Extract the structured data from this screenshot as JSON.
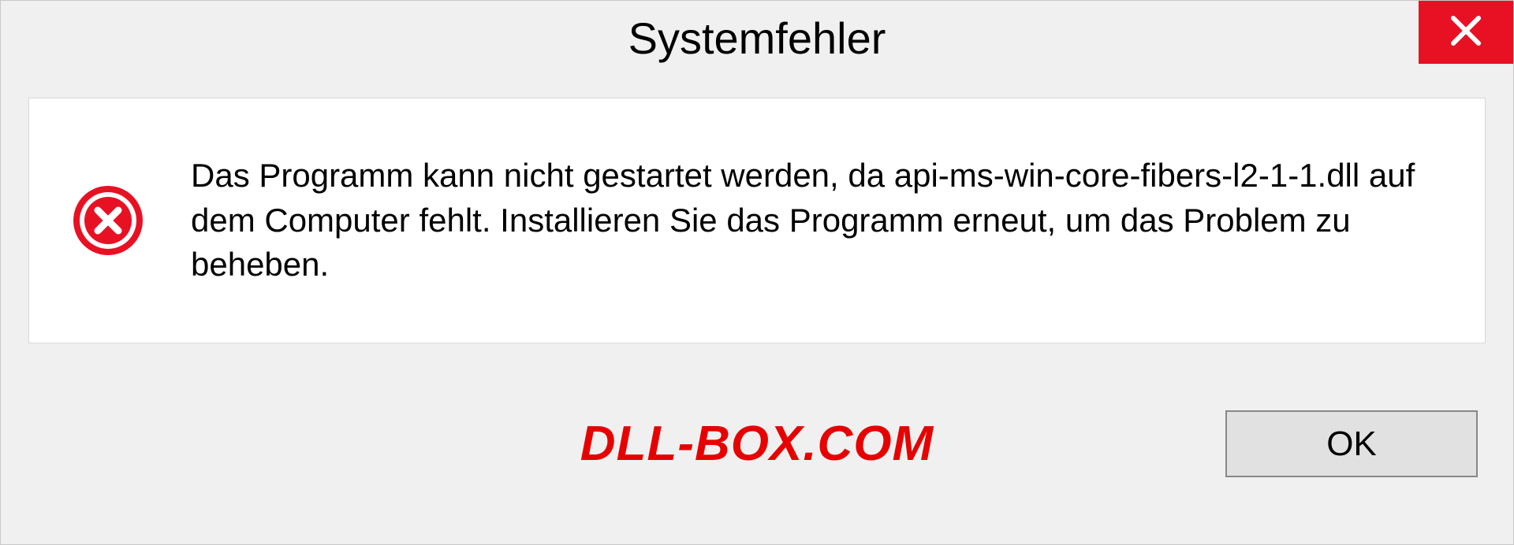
{
  "dialog": {
    "title": "Systemfehler",
    "message": "Das Programm kann nicht gestartet werden, da api-ms-win-core-fibers-l2-1-1.dll auf dem Computer fehlt. Installieren Sie das Programm erneut, um das Problem zu beheben.",
    "ok_label": "OK"
  },
  "watermark": "DLL-BOX.COM",
  "colors": {
    "close_button": "#e81123",
    "watermark": "#e60000"
  }
}
